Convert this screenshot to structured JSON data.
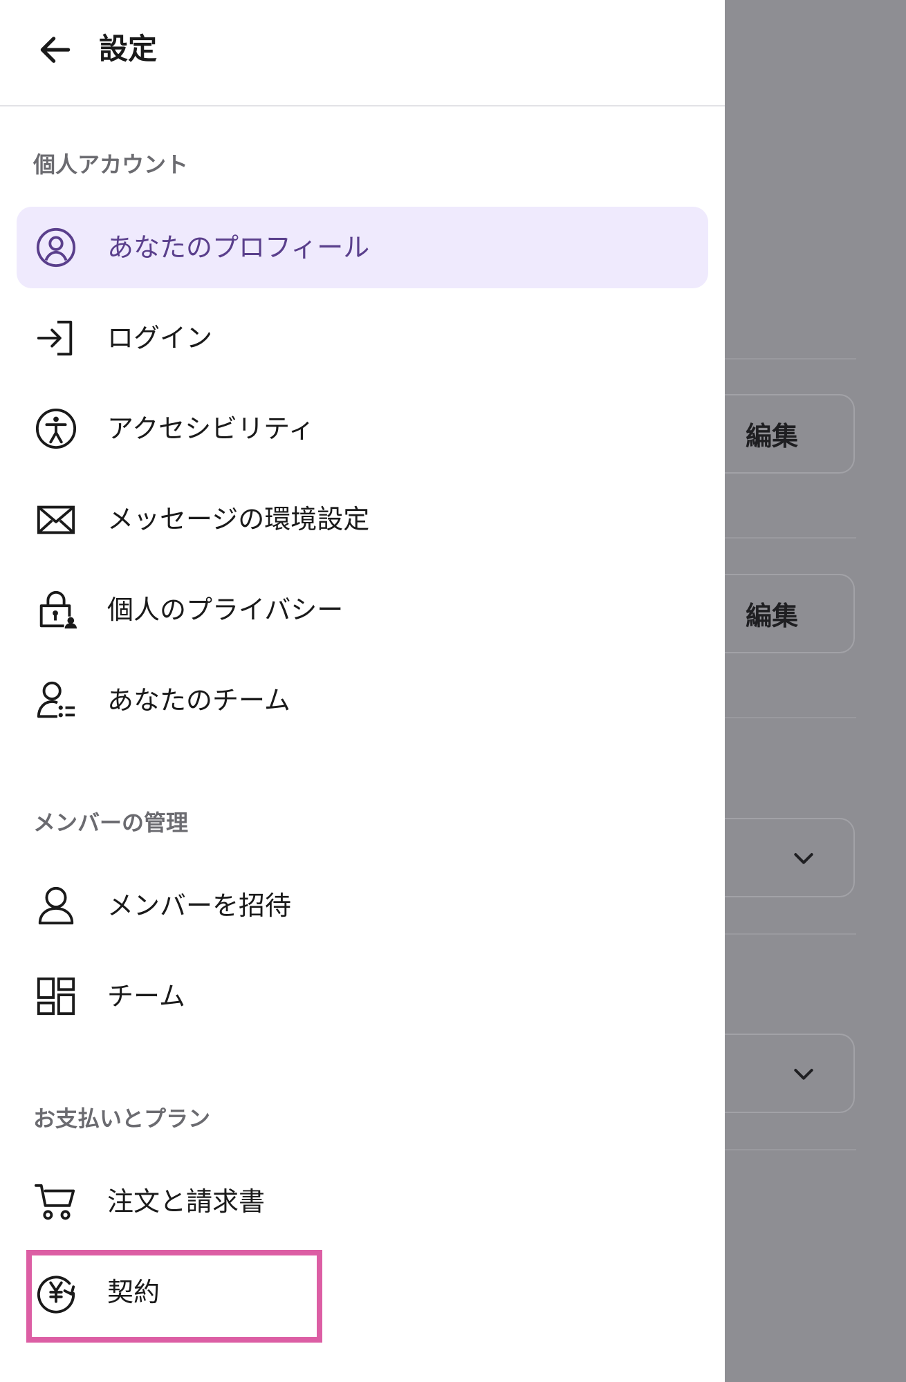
{
  "header": {
    "title": "設定"
  },
  "sections": {
    "personal": {
      "label": "個人アカウント"
    },
    "members": {
      "label": "メンバーの管理"
    },
    "billing": {
      "label": "お支払いとプラン"
    }
  },
  "items": {
    "profile": {
      "label": "あなたのプロフィール",
      "icon": "user-circle-icon"
    },
    "login": {
      "label": "ログイン",
      "icon": "login-icon"
    },
    "accessibility": {
      "label": "アクセシビリティ",
      "icon": "accessibility-icon"
    },
    "messages": {
      "label": "メッセージの環境設定",
      "icon": "mail-icon"
    },
    "privacy": {
      "label": "個人のプライバシー",
      "icon": "lock-user-icon"
    },
    "team": {
      "label": "あなたのチーム",
      "icon": "team-user-icon"
    },
    "invite": {
      "label": "メンバーを招待",
      "icon": "person-icon"
    },
    "teams": {
      "label": "チーム",
      "icon": "grid-icon"
    },
    "orders": {
      "label": "注文と請求書",
      "icon": "cart-icon"
    },
    "contract": {
      "label": "契約",
      "icon": "yen-cycle-icon"
    }
  },
  "background": {
    "edit_label_1": "編集",
    "edit_label_2": "編集"
  },
  "colors": {
    "active_bg": "#efeafd",
    "active_text": "#5a3f8c",
    "highlight": "#dc5ea4",
    "overlay": "#8e8e93"
  }
}
